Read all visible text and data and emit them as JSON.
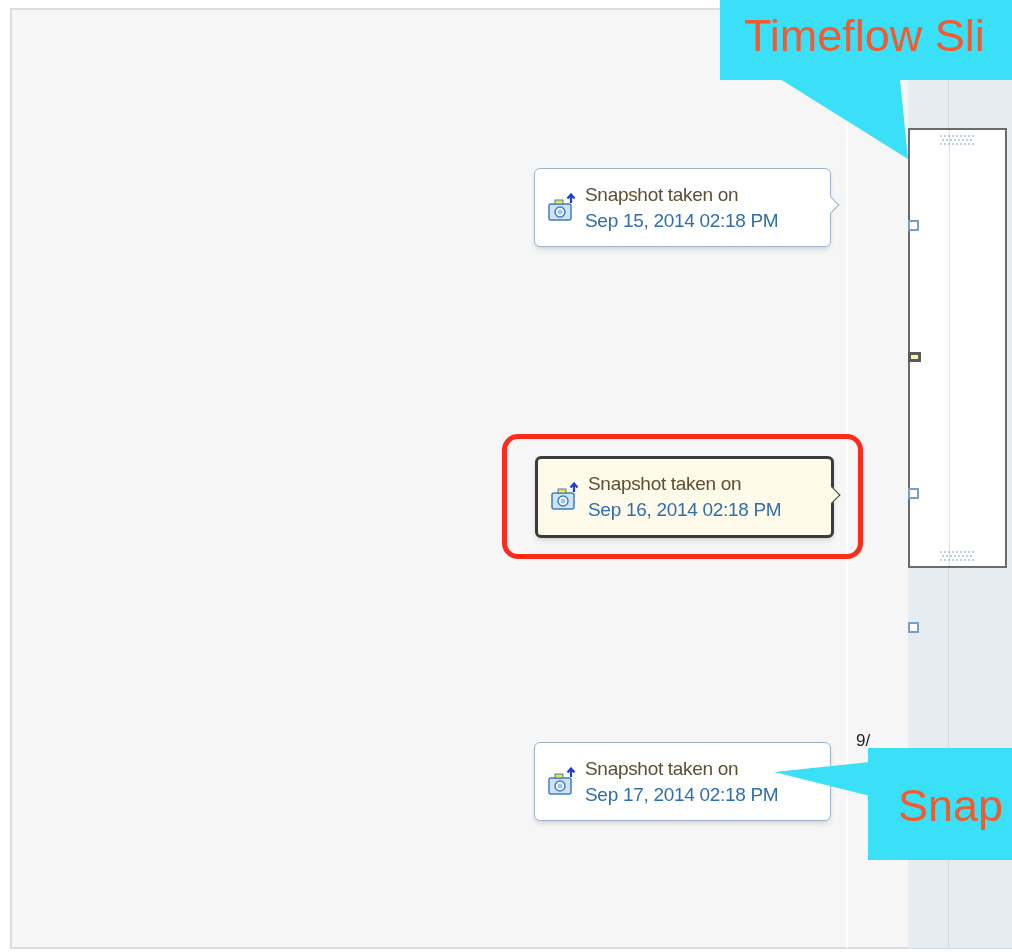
{
  "snapshots": [
    {
      "title": "Snapshot taken on",
      "date": "Sep 15, 2014 02:18 PM",
      "selected": false,
      "highlighted": false
    },
    {
      "title": "Snapshot taken on",
      "date": "Sep 16, 2014 02:18 PM",
      "selected": true,
      "highlighted": true
    },
    {
      "title": "Snapshot taken on",
      "date": "Sep 17, 2014 02:18 PM",
      "selected": false,
      "highlighted": false
    }
  ],
  "timeflow": {
    "markers": [
      {
        "selected": false
      },
      {
        "selected": true
      },
      {
        "selected": false
      },
      {
        "selected": false
      }
    ],
    "date_label": "9/"
  },
  "callouts": [
    {
      "text": "Timeflow Sli"
    },
    {
      "text": "Snap"
    }
  ]
}
